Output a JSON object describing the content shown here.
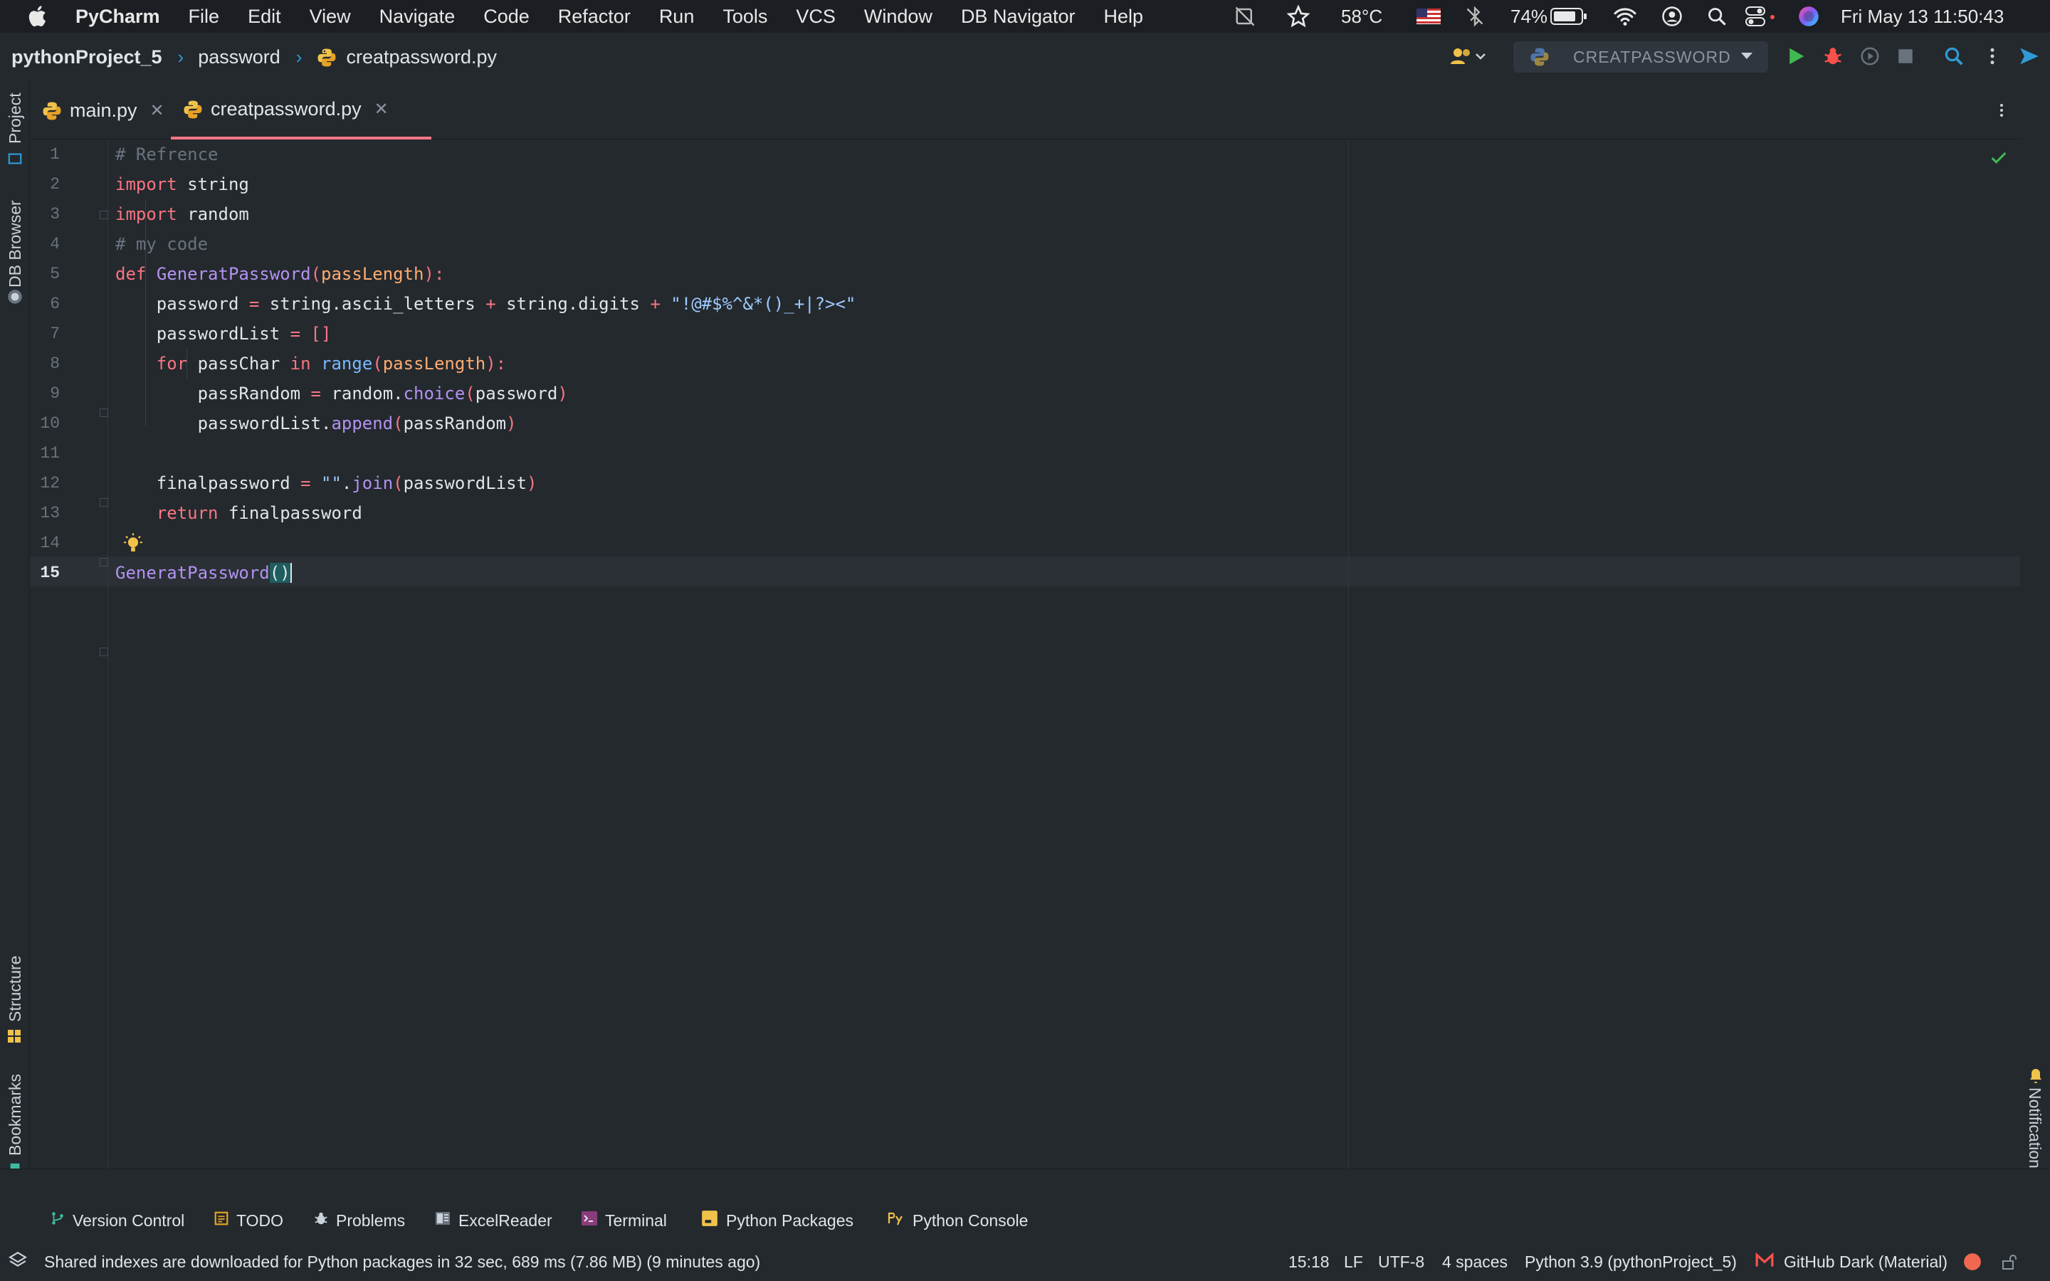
{
  "menubar": {
    "app_name": "PyCharm",
    "items": [
      "File",
      "Edit",
      "View",
      "Navigate",
      "Code",
      "Refactor",
      "Run",
      "Tools",
      "VCS",
      "Window",
      "DB Navigator",
      "Help"
    ],
    "temperature": "58°C",
    "battery": "74%",
    "datetime": "Fri May 13  11:50:43"
  },
  "navbar": {
    "project": "pythonProject_5",
    "folder": "password",
    "file": "creatpassword.py",
    "run_config": "CREATPASSWORD"
  },
  "left_stripe": {
    "project": "Project",
    "db_browser": "DB Browser",
    "structure": "Structure",
    "bookmarks": "Bookmarks"
  },
  "right_stripe": {
    "notifications": "Notifications"
  },
  "tabs": [
    {
      "label": "main.py",
      "active": false
    },
    {
      "label": "creatpassword.py",
      "active": true
    }
  ],
  "editor": {
    "line_numbers": [
      "1",
      "2",
      "3",
      "4",
      "5",
      "6",
      "7",
      "8",
      "9",
      "10",
      "11",
      "12",
      "13",
      "14",
      "15"
    ],
    "current_line": "15"
  },
  "tool_windows": [
    {
      "label": "Version Control",
      "icon": "branch-icon"
    },
    {
      "label": "TODO",
      "icon": "todo-icon"
    },
    {
      "label": "Problems",
      "icon": "bug-icon"
    },
    {
      "label": "ExcelReader",
      "icon": "excel-icon"
    },
    {
      "label": "Terminal",
      "icon": "terminal-icon"
    },
    {
      "label": "Python Packages",
      "icon": "package-icon"
    },
    {
      "label": "Python Console",
      "icon": "python-console-icon"
    }
  ],
  "statusbar": {
    "message": "Shared indexes are downloaded for Python packages in 32 sec, 689 ms (7.86 MB) (9 minutes ago)",
    "caret": "15:18",
    "line_sep": "LF",
    "encoding": "UTF-8",
    "indent": "4 spaces",
    "interpreter": "Python 3.9 (pythonProject_5)",
    "theme": "GitHub Dark (Material)"
  },
  "colors": {
    "background": "#24292e",
    "keyword": "#f97583",
    "function": "#b392f0",
    "string": "#9ecbff",
    "comment": "#6a737d",
    "param": "#ffab70",
    "accent": "#2f9bd6"
  }
}
